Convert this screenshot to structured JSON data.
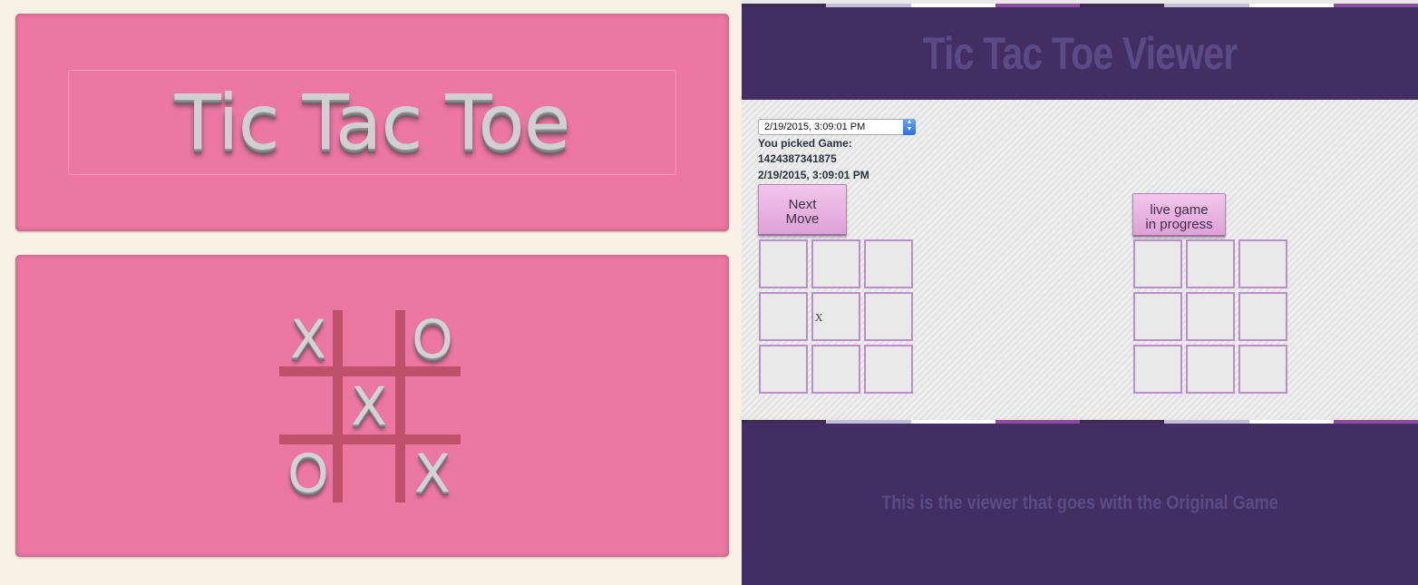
{
  "game": {
    "title": "Tic Tac Toe",
    "board": [
      "X",
      "",
      "O",
      "",
      "X",
      "",
      "O",
      "",
      "X"
    ]
  },
  "viewer": {
    "title": "Tic Tac Toe Viewer",
    "select_value": "2/19/2015, 3:09:01 PM",
    "picked_label": "You picked Game:",
    "picked_id": "1424387341875",
    "picked_date": "2/19/2015, 3:09:01 PM",
    "next_move_line1": "Next",
    "next_move_line2": "Move",
    "live_line1": "live game",
    "live_line2": "in progress",
    "replay_board": [
      "",
      "",
      "",
      "",
      "x",
      "",
      "",
      "",
      ""
    ],
    "live_board": [
      "",
      "",
      "",
      "",
      "",
      "",
      "",
      "",
      ""
    ],
    "footer_text": "This is the viewer that goes with the Original Game"
  },
  "colors": {
    "card_pink": "#ec78a2",
    "grid_line": "#be5069",
    "viewer_purple": "#422e63",
    "cell_border": "#b88fc9",
    "stripes": [
      "#3a2d50",
      "#c3c0d6",
      "#ffffff",
      "#8f4b9e",
      "#3a2d50",
      "#c3c0d6",
      "#ffffff",
      "#8f4b9e"
    ]
  }
}
